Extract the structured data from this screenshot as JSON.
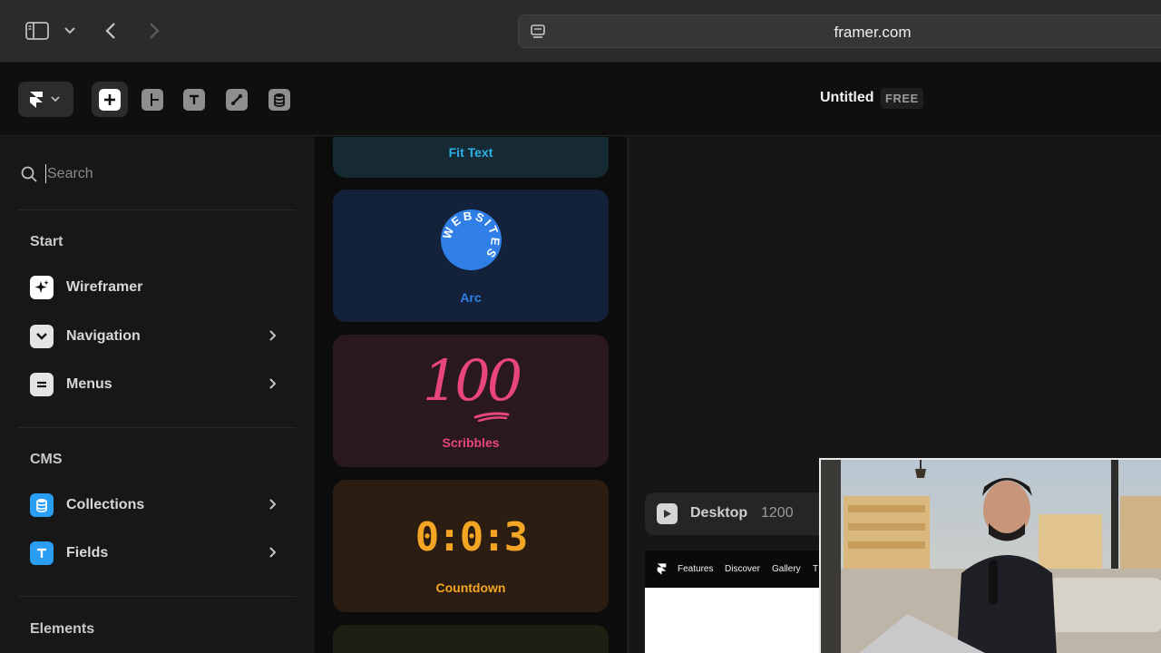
{
  "browser": {
    "url": "framer.com",
    "icons": [
      "sidebar-toggle-icon",
      "chevron-down-icon",
      "back-arrow-icon",
      "forward-arrow-icon",
      "reader-icon"
    ]
  },
  "toolbar": {
    "title": "Untitled",
    "plan_badge": "FREE",
    "tools": [
      "insert",
      "layout",
      "text",
      "vector",
      "cms"
    ]
  },
  "sidebar": {
    "search_placeholder": "Search",
    "sections": [
      {
        "title": "Start",
        "items": [
          {
            "label": "Wireframer",
            "icon": "sparkle-icon",
            "chevron": false
          },
          {
            "label": "Navigation",
            "icon": "chevron-down-icon",
            "chevron": true
          },
          {
            "label": "Menus",
            "icon": "menu-lines-icon",
            "chevron": true
          }
        ]
      },
      {
        "title": "CMS",
        "items": [
          {
            "label": "Collections",
            "icon": "database-icon",
            "chevron": true
          },
          {
            "label": "Fields",
            "icon": "text-t-icon",
            "chevron": true
          }
        ]
      },
      {
        "title": "Elements",
        "items": []
      }
    ]
  },
  "components": [
    {
      "label": "Fit Text",
      "color": "#2fb0e6",
      "bg": "#152a33"
    },
    {
      "label": "Arc",
      "color": "#2f7fe6",
      "bg": "#14213a",
      "preview_text": "WEBSITES"
    },
    {
      "label": "Scribbles",
      "color": "#e8457e",
      "bg": "#2a1820",
      "preview_text": "100"
    },
    {
      "label": "Countdown",
      "color": "#f5a524",
      "bg": "#2b1d12",
      "preview_text": "0:0:3"
    }
  ],
  "canvas": {
    "frame_name": "Desktop",
    "frame_width": "1200",
    "preview_nav": [
      "Features",
      "Discover",
      "Gallery",
      "T"
    ]
  },
  "colors": {
    "accent_blue": "#2f7fe6",
    "accent_pink": "#e8457e",
    "accent_orange": "#f5a524",
    "cms_icon_blue": "#2a9df4"
  }
}
